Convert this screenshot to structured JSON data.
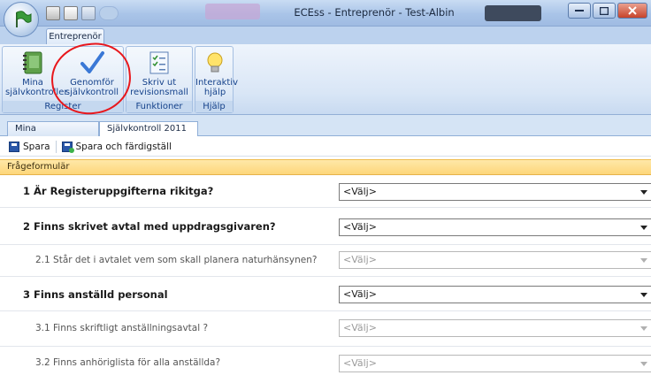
{
  "window": {
    "title": "ECEss - Entreprenör - Test-Albin"
  },
  "ribbon": {
    "active_tab": "Entreprenör",
    "groups": [
      {
        "label": "Register",
        "buttons": [
          {
            "label_line1": "Mina",
            "label_line2": "självkontroller",
            "icon": "notebook-icon"
          },
          {
            "label_line1": "Genomför",
            "label_line2": "självkontroll",
            "icon": "checkmark-icon"
          }
        ]
      },
      {
        "label": "Funktioner",
        "buttons": [
          {
            "label_line1": "Skriv ut",
            "label_line2": "revisionsmall",
            "icon": "checklist-icon"
          }
        ]
      },
      {
        "label": "Hjälp",
        "buttons": [
          {
            "label_line1": "Interaktiv",
            "label_line2": "hjälp",
            "icon": "lightbulb-icon"
          }
        ]
      }
    ]
  },
  "doc_tabs": [
    "Mina självkontroller",
    "Självkontroll 2011"
  ],
  "toolbar": {
    "save_label": "Spara",
    "save_finish_label": "Spara och färdigställ"
  },
  "form": {
    "header": "Frågeformulär",
    "placeholder": "<Välj>",
    "questions": [
      {
        "text": "1 Är Registeruppgifterna rikitga?",
        "sub": false,
        "enabled": true
      },
      {
        "text": "2 Finns skrivet avtal med uppdragsgivaren?",
        "sub": false,
        "enabled": true
      },
      {
        "text": "2.1 Står det i avtalet vem som skall planera naturhänsynen?",
        "sub": true,
        "enabled": false
      },
      {
        "text": "3 Finns anställd personal",
        "sub": false,
        "enabled": true
      },
      {
        "text": "3.1 Finns skriftligt anställningsavtal ?",
        "sub": true,
        "enabled": false
      },
      {
        "text": "3.2 Finns anhöriglista för alla anställda?",
        "sub": true,
        "enabled": false
      }
    ]
  }
}
